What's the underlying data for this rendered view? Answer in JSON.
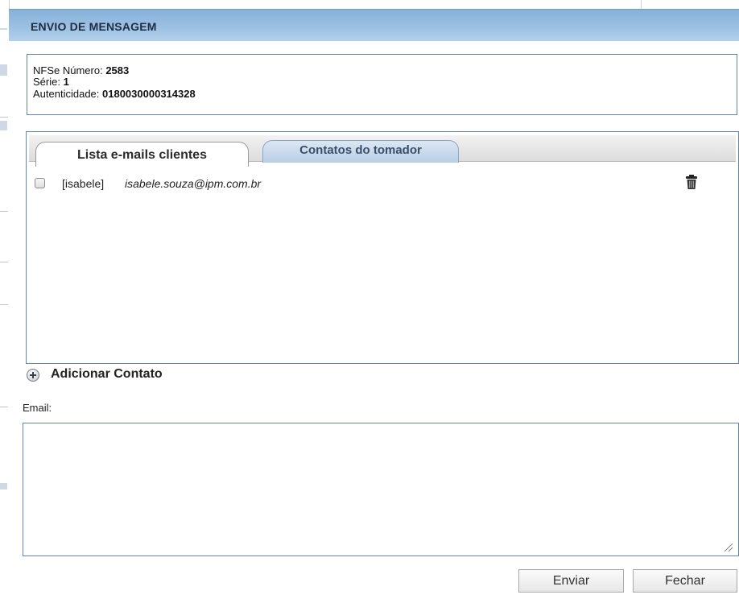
{
  "dialog": {
    "title": "ENVIO DE MENSAGEM"
  },
  "info": {
    "nfse_label": "NFSe Número: ",
    "nfse_value": "2583",
    "serie_label": "Série: ",
    "serie_value": "1",
    "autenticidade_label": "Autenticidade: ",
    "autenticidade_value": "0180030000314328"
  },
  "tabs": [
    {
      "label": "Lista e-mails clientes",
      "active": true
    },
    {
      "label": "Contatos do tomador",
      "active": false
    }
  ],
  "emails": [
    {
      "tag": "[isabele]",
      "email": "isabele.souza@ipm.com.br",
      "checked": false
    }
  ],
  "add_contact": {
    "label": "Adicionar Contato"
  },
  "email_field": {
    "label": "Email:",
    "value": ""
  },
  "buttons": {
    "send": "Enviar",
    "close": "Fechar"
  },
  "icons": {
    "delete": "trash-icon",
    "add": "plus-circle-icon"
  }
}
